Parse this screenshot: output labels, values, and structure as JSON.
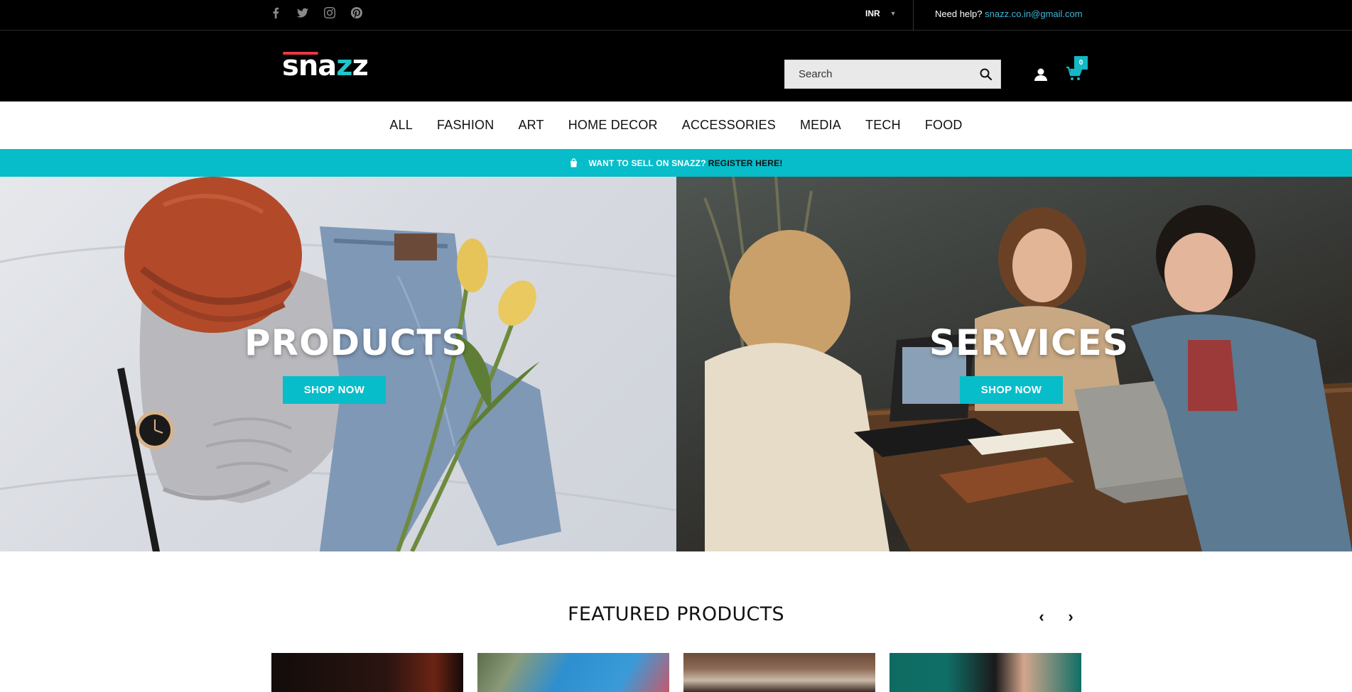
{
  "topbar": {
    "social": [
      "facebook-icon",
      "twitter-icon",
      "instagram-icon",
      "pinterest-icon"
    ],
    "currency": "INR",
    "help_label": "Need help?",
    "help_email": "snazz.co.in@gmail.com"
  },
  "header": {
    "logo_text": "snazz",
    "search_placeholder": "Search",
    "cart_count": "0"
  },
  "nav": {
    "items": [
      "ALL",
      "FASHION",
      "ART",
      "HOME DECOR",
      "ACCESSORIES",
      "MEDIA",
      "TECH",
      "FOOD"
    ]
  },
  "promo": {
    "text": "WANT TO SELL ON SNAZZ?",
    "link": "REGISTER HERE!"
  },
  "hero": {
    "left": {
      "title": "PRODUCTS",
      "button": "SHOP NOW"
    },
    "right": {
      "title": "SERVICES",
      "button": "SHOP NOW"
    }
  },
  "featured": {
    "title": "FEATURED PRODUCTS",
    "prev": "‹",
    "next": "›"
  },
  "colors": {
    "accent": "#07bdc9",
    "topbar_bg": "#000000",
    "email_link": "#3fb6d8",
    "logo_bar": "#e63a45",
    "logo_z": "#20c6c9"
  }
}
